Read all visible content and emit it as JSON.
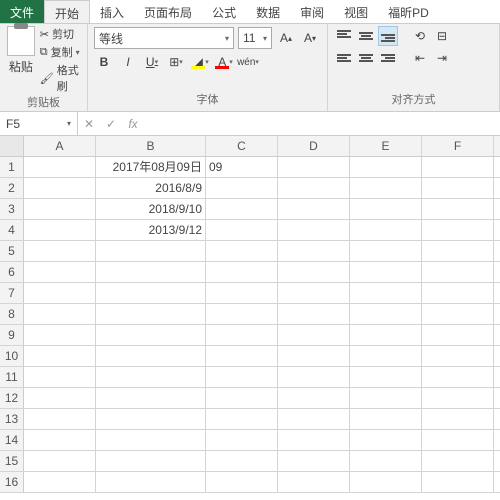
{
  "tabs": {
    "file": "文件",
    "home": "开始",
    "insert": "插入",
    "layout": "页面布局",
    "formula": "公式",
    "data": "数据",
    "review": "审阅",
    "view": "视图",
    "foxit": "福昕PD"
  },
  "ribbon": {
    "clipboard": {
      "paste": "粘贴",
      "cut": "剪切",
      "copy": "复制",
      "painter": "格式刷",
      "label": "剪贴板"
    },
    "font": {
      "name": "等线",
      "size": "11",
      "label": "字体",
      "bold": "B",
      "italic": "I",
      "underline": "U",
      "wen": "wén"
    },
    "align": {
      "label": "对齐方式"
    }
  },
  "fx": {
    "cell": "F5",
    "fxlabel": "fx"
  },
  "cols": [
    "A",
    "B",
    "C",
    "D",
    "E",
    "F"
  ],
  "cells": {
    "B1": "2017年08月09日",
    "C1": "09",
    "B2": "2016/8/9",
    "B3": "2018/9/10",
    "B4": "2013/9/12"
  }
}
